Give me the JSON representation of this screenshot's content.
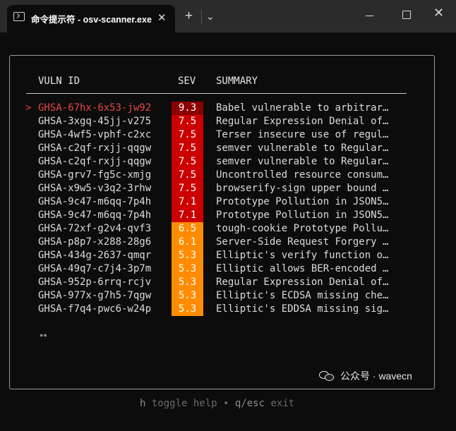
{
  "window": {
    "tab_title": "命令提示符 - osv-scanner.exe",
    "tab_close": "✕",
    "new_tab": "+",
    "dropdown": "⌄",
    "close": "✕"
  },
  "table": {
    "headers": {
      "id": "VULN ID",
      "sev": "SEV",
      "summary": "SUMMARY"
    },
    "selected_marker": ">",
    "rows": [
      {
        "id": "GHSA-67hx-6x53-jw92",
        "sev": "9.3",
        "sev_color": "#8b0000",
        "summary": "Babel vulnerable to arbitrar…"
      },
      {
        "id": "GHSA-3xgq-45jj-v275",
        "sev": "7.5",
        "sev_color": "#cc0000",
        "summary": "Regular Expression Denial of…"
      },
      {
        "id": "GHSA-4wf5-vphf-c2xc",
        "sev": "7.5",
        "sev_color": "#cc0000",
        "summary": "Terser insecure use of regul…"
      },
      {
        "id": "GHSA-c2qf-rxjj-qqgw",
        "sev": "7.5",
        "sev_color": "#cc0000",
        "summary": "semver vulnerable to Regular…"
      },
      {
        "id": "GHSA-c2qf-rxjj-qqgw",
        "sev": "7.5",
        "sev_color": "#cc0000",
        "summary": "semver vulnerable to Regular…"
      },
      {
        "id": "GHSA-grv7-fg5c-xmjg",
        "sev": "7.5",
        "sev_color": "#cc0000",
        "summary": "Uncontrolled resource consum…"
      },
      {
        "id": "GHSA-x9w5-v3q2-3rhw",
        "sev": "7.5",
        "sev_color": "#cc0000",
        "summary": "browserify-sign upper bound …"
      },
      {
        "id": "GHSA-9c47-m6qq-7p4h",
        "sev": "7.1",
        "sev_color": "#cc0000",
        "summary": "Prototype Pollution in JSON5…"
      },
      {
        "id": "GHSA-9c47-m6qq-7p4h",
        "sev": "7.1",
        "sev_color": "#cc0000",
        "summary": "Prototype Pollution in JSON5…"
      },
      {
        "id": "GHSA-72xf-g2v4-qvf3",
        "sev": "6.5",
        "sev_color": "#ff8c00",
        "summary": "tough-cookie Prototype Pollu…"
      },
      {
        "id": "GHSA-p8p7-x288-28g6",
        "sev": "6.1",
        "sev_color": "#ff8c00",
        "summary": "Server-Side Request Forgery …"
      },
      {
        "id": "GHSA-434g-2637-qmqr",
        "sev": "5.3",
        "sev_color": "#ff8c00",
        "summary": "Elliptic's verify function o…"
      },
      {
        "id": "GHSA-49q7-c7j4-3p7m",
        "sev": "5.3",
        "sev_color": "#ff8c00",
        "summary": "Elliptic allows BER-encoded …"
      },
      {
        "id": "GHSA-952p-6rrq-rcjv",
        "sev": "5.3",
        "sev_color": "#ff8c00",
        "summary": "Regular Expression Denial of…"
      },
      {
        "id": "GHSA-977x-g7h5-7qgw",
        "sev": "5.3",
        "sev_color": "#ff8c00",
        "summary": "Elliptic's ECDSA missing che…"
      },
      {
        "id": "GHSA-f7q4-pwc6-w24p",
        "sev": "5.3",
        "sev_color": "#ff8c00",
        "summary": "Elliptic's EDDSA missing sig…"
      }
    ]
  },
  "pagination": "●●",
  "footer": {
    "key1": "h",
    "text1": " toggle help • ",
    "key2": "q/esc",
    "text2": " exit"
  },
  "watermark": "公众号 · wavecn"
}
